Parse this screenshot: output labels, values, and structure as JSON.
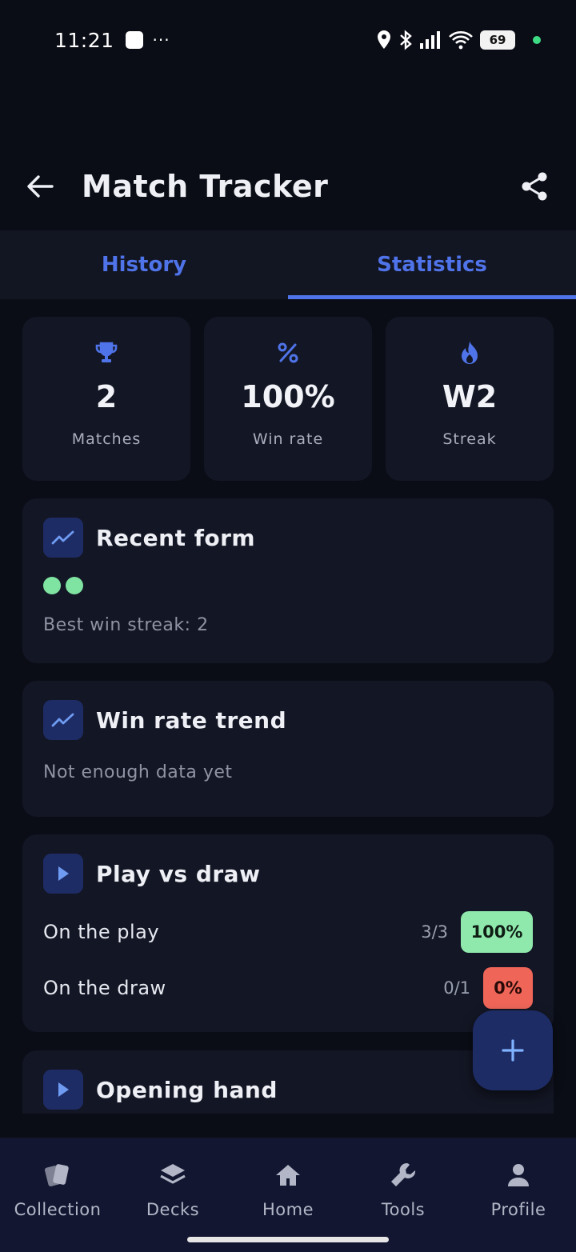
{
  "status_bar": {
    "time": "11:21",
    "dots": "···",
    "battery": "69"
  },
  "app_bar": {
    "title": "Match Tracker",
    "back_icon": "arrow-left-icon",
    "share_icon": "share-icon"
  },
  "tabs": [
    {
      "label": "History",
      "active": false
    },
    {
      "label": "Statistics",
      "active": true
    }
  ],
  "stats": [
    {
      "icon": "trophy-icon",
      "value": "2",
      "label": "Matches"
    },
    {
      "icon": "percent-icon",
      "value": "100%",
      "label": "Win rate"
    },
    {
      "icon": "flame-icon",
      "value": "W2",
      "label": "Streak"
    }
  ],
  "recent_form": {
    "title": "Recent form",
    "results": [
      "win",
      "win"
    ],
    "best_streak": "Best win streak: 2"
  },
  "win_rate_trend": {
    "title": "Win rate trend",
    "message": "Not enough data yet"
  },
  "play_vs_draw": {
    "title": "Play vs draw",
    "rows": [
      {
        "label": "On the play",
        "count": "3/3",
        "rate": "100%"
      },
      {
        "label": "On the draw",
        "count": "0/1",
        "rate": "0%"
      }
    ]
  },
  "opening_hand": {
    "title": "Opening hand"
  },
  "fab": {
    "icon": "plus-icon"
  },
  "bottom_nav": [
    {
      "label": "Collection",
      "icon": "cards-icon"
    },
    {
      "label": "Decks",
      "icon": "layers-icon"
    },
    {
      "label": "Home",
      "icon": "home-icon"
    },
    {
      "label": "Tools",
      "icon": "wrench-icon"
    },
    {
      "label": "Profile",
      "icon": "person-icon"
    }
  ],
  "colors": {
    "accent": "#4f73e8",
    "win": "#8fe9ad",
    "loss": "#ef6659",
    "background": "#0b0d16",
    "card": "#131624"
  }
}
